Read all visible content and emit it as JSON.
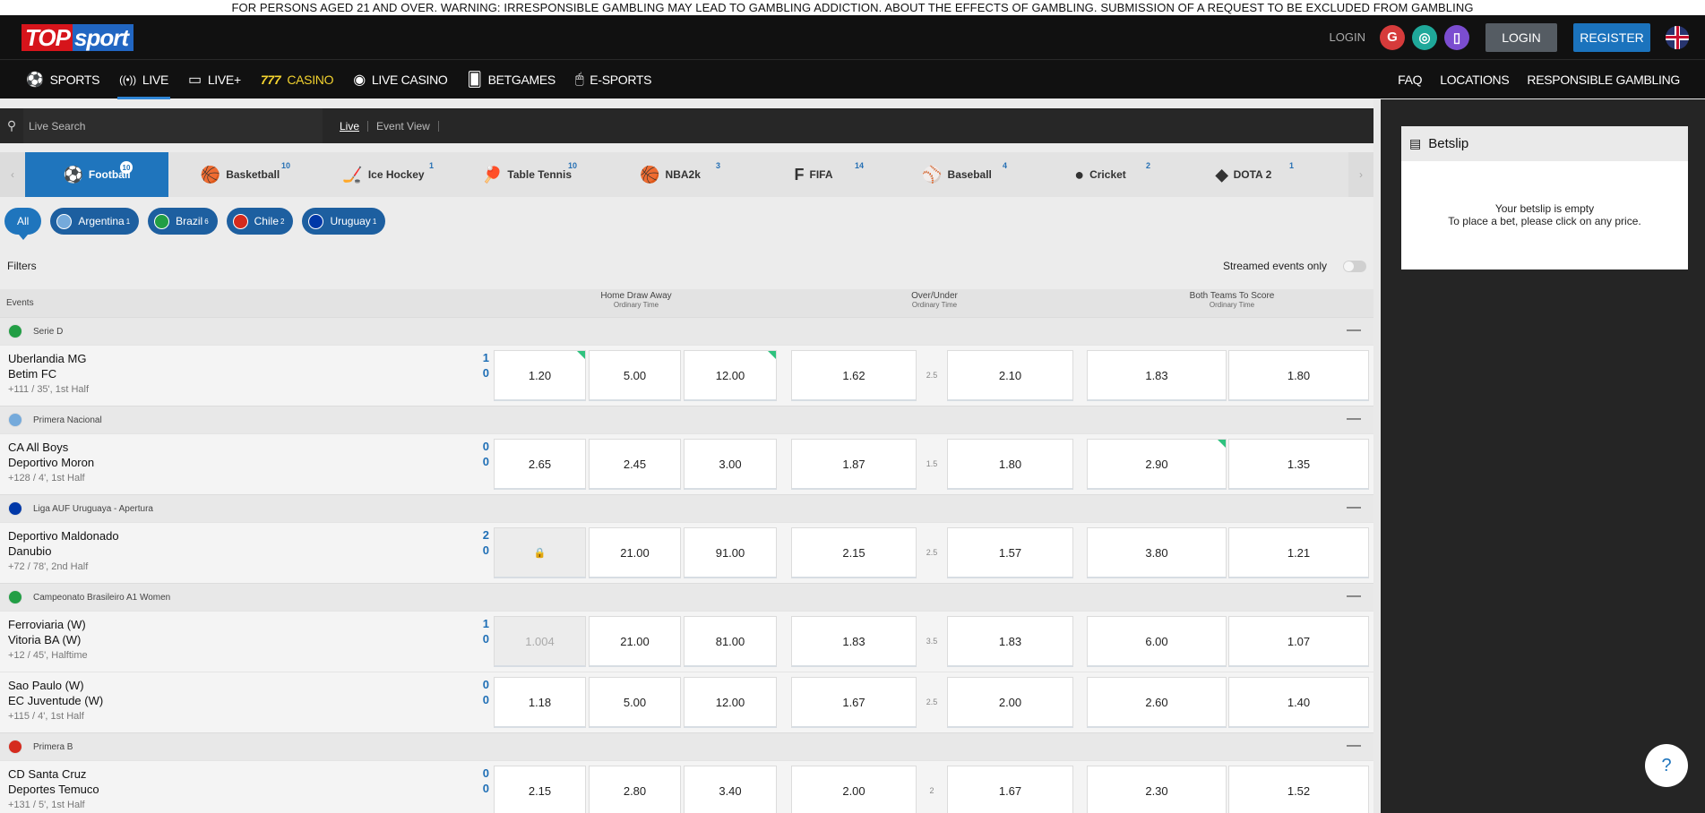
{
  "warning": "FOR PERSONS AGED 21 AND OVER. WARNING: IRRESPONSIBLE GAMBLING MAY LEAD TO GAMBLING ADDICTION. ABOUT THE EFFECTS OF GAMBLING. SUBMISSION OF A REQUEST TO BE EXCLUDED FROM GAMBLING",
  "logo": {
    "part1": "TOP",
    "part2": "sport"
  },
  "header": {
    "login_link": "LOGIN",
    "login_button": "LOGIN",
    "register_button": "REGISTER",
    "social": [
      {
        "icon": "google-icon",
        "glyph": "G",
        "color": "#d63b3b"
      },
      {
        "icon": "openid-icon",
        "glyph": "◎",
        "color": "#1fa89a"
      },
      {
        "icon": "phone-icon",
        "glyph": "▯",
        "color": "#7b4dd0"
      }
    ]
  },
  "nav": {
    "items": [
      {
        "label": "SPORTS",
        "icon": "⚽",
        "name": "sports"
      },
      {
        "label": "LIVE",
        "icon": "((•))",
        "name": "live"
      },
      {
        "label": "LIVE+",
        "icon": "▭",
        "name": "live-plus"
      },
      {
        "label": "CASINO",
        "icon": "777",
        "name": "casino"
      },
      {
        "label": "LIVE CASINO",
        "icon": "◉",
        "name": "live-casino"
      },
      {
        "label": "BETGAMES",
        "icon": "🂠",
        "name": "betgames"
      },
      {
        "label": "E-SPORTS",
        "icon": "🖱",
        "name": "e-sports"
      }
    ],
    "right": [
      "FAQ",
      "LOCATIONS",
      "RESPONSIBLE GAMBLING"
    ]
  },
  "search": {
    "placeholder": "Live Search",
    "tabs": [
      "Live",
      "Event View"
    ]
  },
  "sports": [
    {
      "label": "Football",
      "count": "10",
      "icon": "⚽"
    },
    {
      "label": "Basketball",
      "count": "10",
      "icon": "🏀"
    },
    {
      "label": "Ice Hockey",
      "count": "1",
      "icon": "🏒"
    },
    {
      "label": "Table Tennis",
      "count": "10",
      "icon": "🏓"
    },
    {
      "label": "NBA2k",
      "count": "3",
      "icon": "🏀"
    },
    {
      "label": "FIFA",
      "count": "14",
      "icon": "F"
    },
    {
      "label": "Baseball",
      "count": "4",
      "icon": "⚾"
    },
    {
      "label": "Cricket",
      "count": "2",
      "icon": "●"
    },
    {
      "label": "DOTA 2",
      "count": "1",
      "icon": "◆"
    }
  ],
  "countries": [
    {
      "label": "All",
      "count": ""
    },
    {
      "label": "Argentina",
      "count": "1",
      "color": "#75aadb"
    },
    {
      "label": "Brazil",
      "count": "6",
      "color": "#229e45"
    },
    {
      "label": "Chile",
      "count": "2",
      "color": "#d52b1e"
    },
    {
      "label": "Uruguay",
      "count": "1",
      "color": "#0038a8"
    }
  ],
  "filters": {
    "label": "Filters",
    "streamed": "Streamed events only"
  },
  "columns": {
    "events": "Events",
    "groups": [
      {
        "title": "Home Draw Away",
        "sub": "Ordinary Time"
      },
      {
        "title": "Over/Under",
        "sub": "Ordinary Time"
      },
      {
        "title": "Both Teams To Score",
        "sub": "Ordinary Time"
      }
    ]
  },
  "events": [
    {
      "type": "league",
      "name": "Serie D",
      "flag": "#229e45"
    },
    {
      "type": "match",
      "home": "Uberlandia MG",
      "away": "Betim FC",
      "meta": "+111 / 35', 1st Half",
      "score_home": "1",
      "score_away": "0",
      "odds": [
        "1.20",
        "5.00",
        "12.00",
        "1.62",
        "2.10",
        "1.83",
        "1.80"
      ],
      "line": "2.5",
      "up": [
        0,
        2
      ],
      "locked": [],
      "disabled": []
    },
    {
      "type": "league",
      "name": "Primera Nacional",
      "flag": "#75aadb"
    },
    {
      "type": "match",
      "home": "CA All Boys",
      "away": "Deportivo Moron",
      "meta": "+128 / 4', 1st Half",
      "score_home": "0",
      "score_away": "0",
      "odds": [
        "2.65",
        "2.45",
        "3.00",
        "1.87",
        "1.80",
        "2.90",
        "1.35"
      ],
      "line": "1.5",
      "up": [
        5
      ],
      "locked": [],
      "disabled": []
    },
    {
      "type": "league",
      "name": "Liga AUF Uruguaya - Apertura",
      "flag": "#0038a8"
    },
    {
      "type": "match",
      "home": "Deportivo Maldonado",
      "away": "Danubio",
      "meta": "+72 / 78', 2nd Half",
      "score_home": "2",
      "score_away": "0",
      "odds": [
        "",
        "21.00",
        "91.00",
        "2.15",
        "1.57",
        "3.80",
        "1.21"
      ],
      "line": "2.5",
      "up": [],
      "locked": [
        0
      ],
      "disabled": []
    },
    {
      "type": "league",
      "name": "Campeonato Brasileiro A1 Women",
      "flag": "#229e45"
    },
    {
      "type": "match",
      "home": "Ferroviaria (W)",
      "away": "Vitoria BA (W)",
      "meta": "+12 / 45', Halftime",
      "score_home": "1",
      "score_away": "0",
      "odds": [
        "1.004",
        "21.00",
        "81.00",
        "1.83",
        "1.83",
        "6.00",
        "1.07"
      ],
      "line": "3.5",
      "up": [],
      "locked": [],
      "disabled": [
        0
      ]
    },
    {
      "type": "match",
      "home": "Sao Paulo (W)",
      "away": "EC Juventude (W)",
      "meta": "+115 / 4', 1st Half",
      "score_home": "0",
      "score_away": "0",
      "odds": [
        "1.18",
        "5.00",
        "12.00",
        "1.67",
        "2.00",
        "2.60",
        "1.40"
      ],
      "line": "2.5",
      "up": [],
      "locked": [],
      "disabled": []
    },
    {
      "type": "league",
      "name": "Primera B",
      "flag": "#d52b1e"
    },
    {
      "type": "match",
      "home": "CD Santa Cruz",
      "away": "Deportes Temuco",
      "meta": "+131 / 5', 1st Half",
      "score_home": "0",
      "score_away": "0",
      "odds": [
        "2.15",
        "2.80",
        "3.40",
        "2.00",
        "1.67",
        "2.30",
        "1.52"
      ],
      "line": "2",
      "up": [],
      "locked": [],
      "disabled": []
    }
  ],
  "betslip": {
    "title": "Betslip",
    "line1": "Your betslip is empty",
    "line2": "To place a bet, please click on any price."
  }
}
